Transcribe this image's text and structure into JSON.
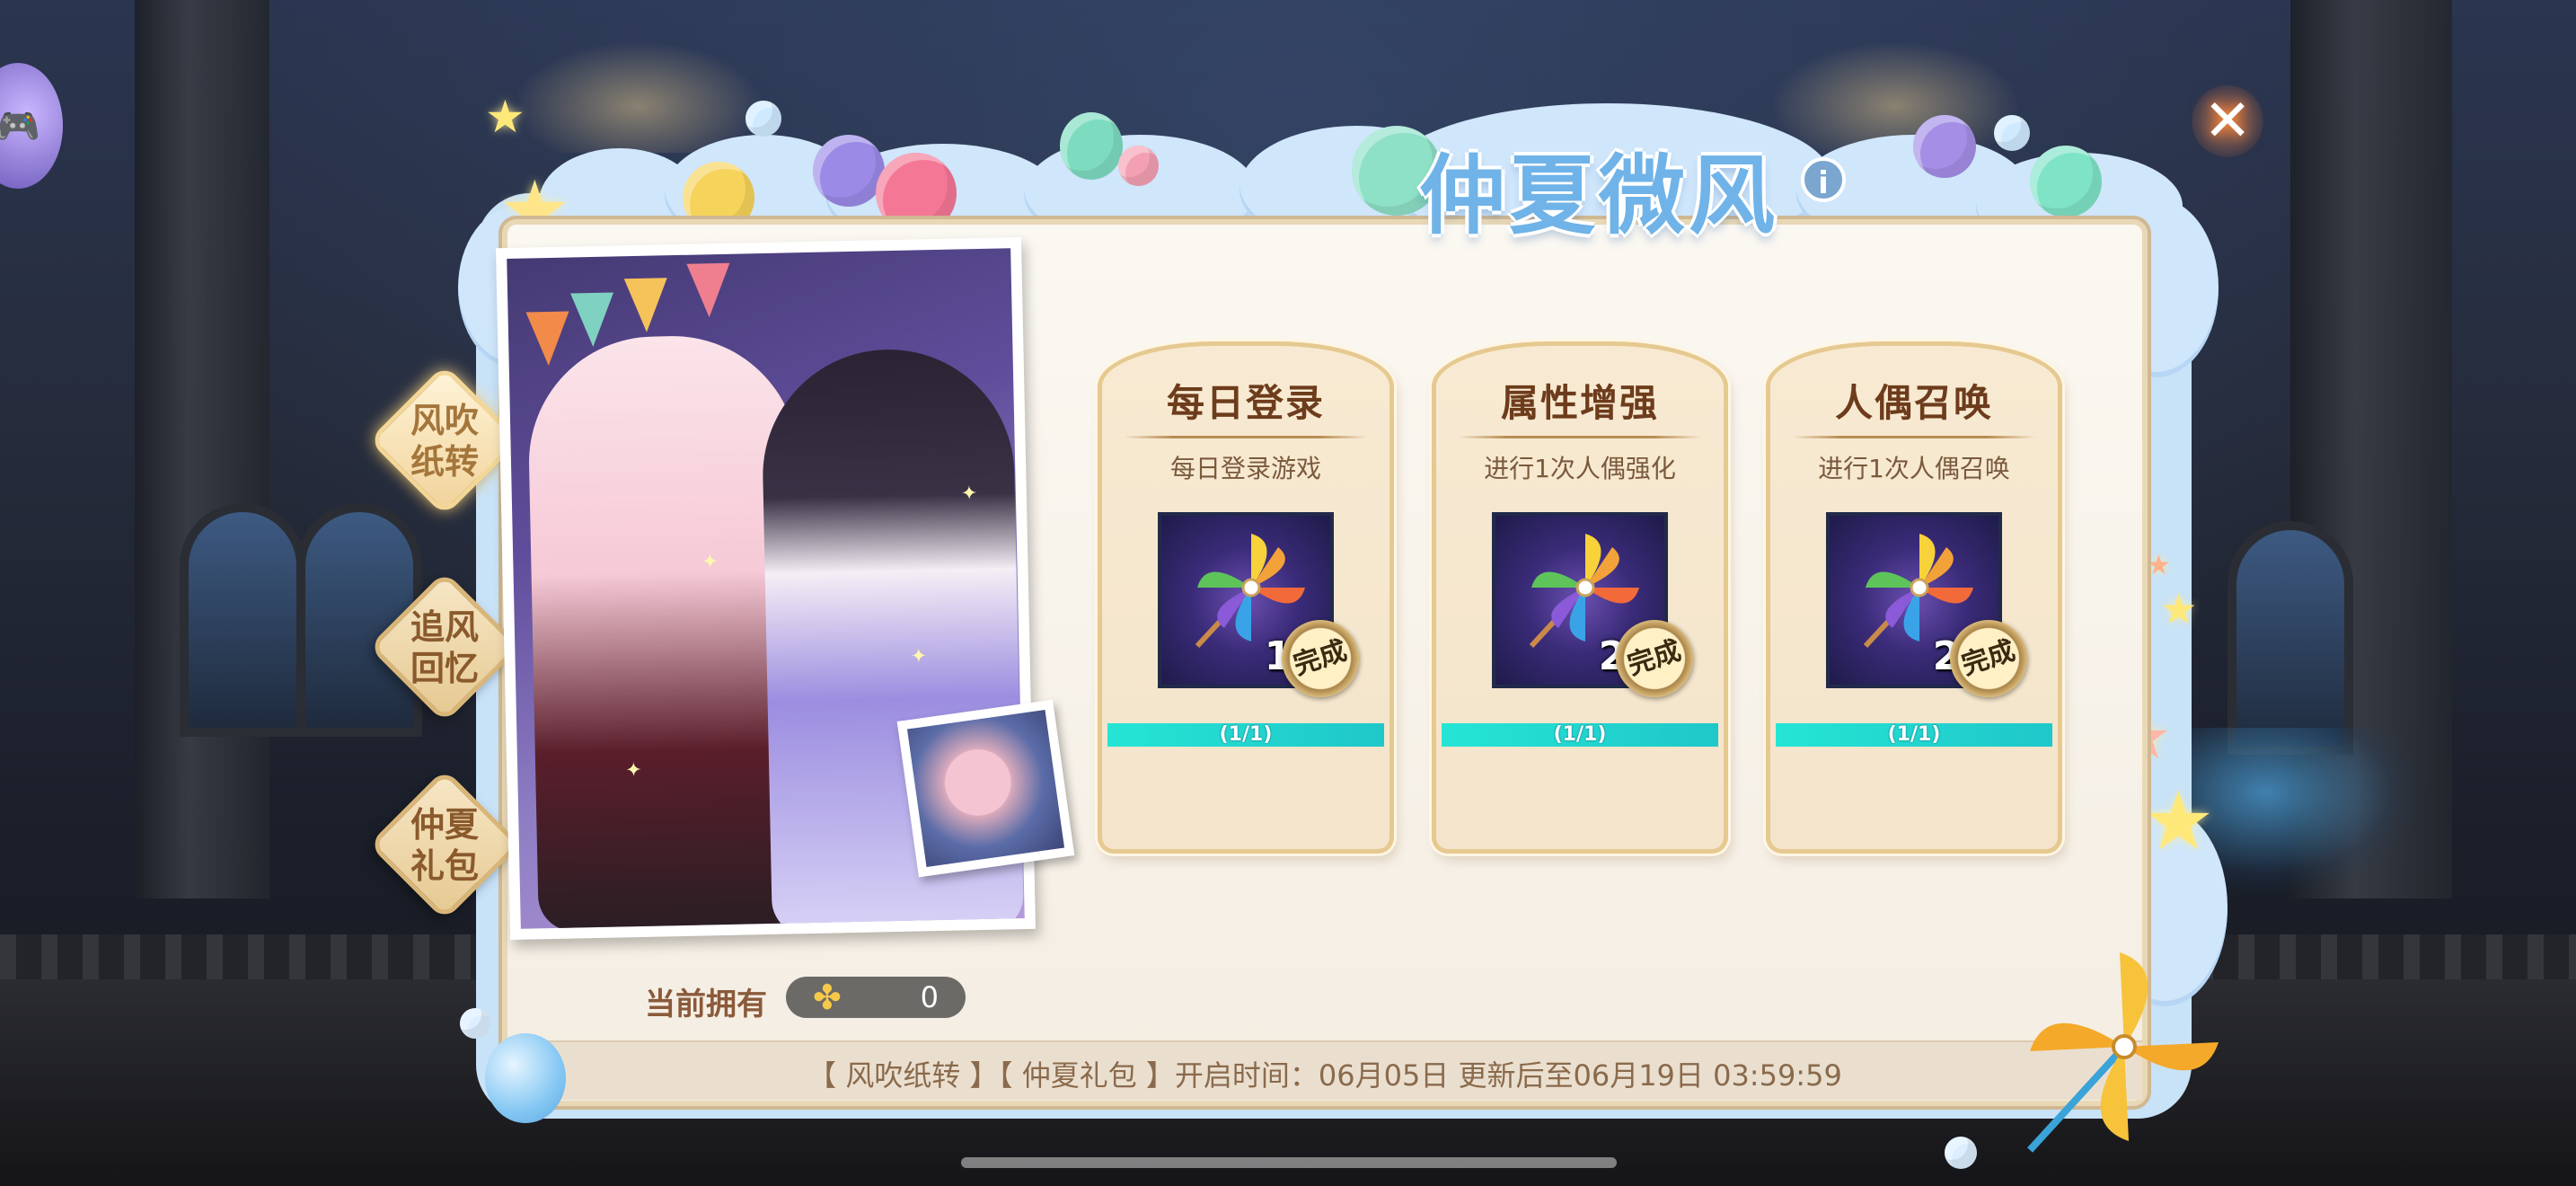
{
  "event": {
    "title": "仲夏微风",
    "info_icon": "i",
    "close_icon": "✕"
  },
  "side_tabs": [
    {
      "label_line1": "风吹",
      "label_line2": "纸转",
      "active": true
    },
    {
      "label_line1": "追风",
      "label_line2": "回忆",
      "active": false
    },
    {
      "label_line1": "仲夏",
      "label_line2": "礼包",
      "active": false
    }
  ],
  "currency": {
    "label": "当前拥有",
    "icon": "pinwheel-icon",
    "value": "0"
  },
  "tasks": [
    {
      "title": "每日登录",
      "desc": "每日登录游戏",
      "reward_qty": "10",
      "status": "完成",
      "progress_text": "(1/1)",
      "progress": 1.0
    },
    {
      "title": "属性增强",
      "desc": "进行1次人偶强化",
      "reward_qty": "20",
      "status": "完成",
      "progress_text": "(1/1)",
      "progress": 1.0
    },
    {
      "title": "人偶召唤",
      "desc": "进行1次人偶召唤",
      "reward_qty": "20",
      "status": "完成",
      "progress_text": "(1/1)",
      "progress": 1.0
    }
  ],
  "footer": {
    "text": "【 风吹纸转 】【 仲夏礼包 】开启时间：06月05日 更新后至06月19日 03:59:59"
  },
  "colors": {
    "title": "#6fb3e8",
    "card_border": "#e6c990",
    "progress_fill": "#25e5d5",
    "progress_track": "#5a8cae",
    "close_glow": "#ff8a3a"
  }
}
